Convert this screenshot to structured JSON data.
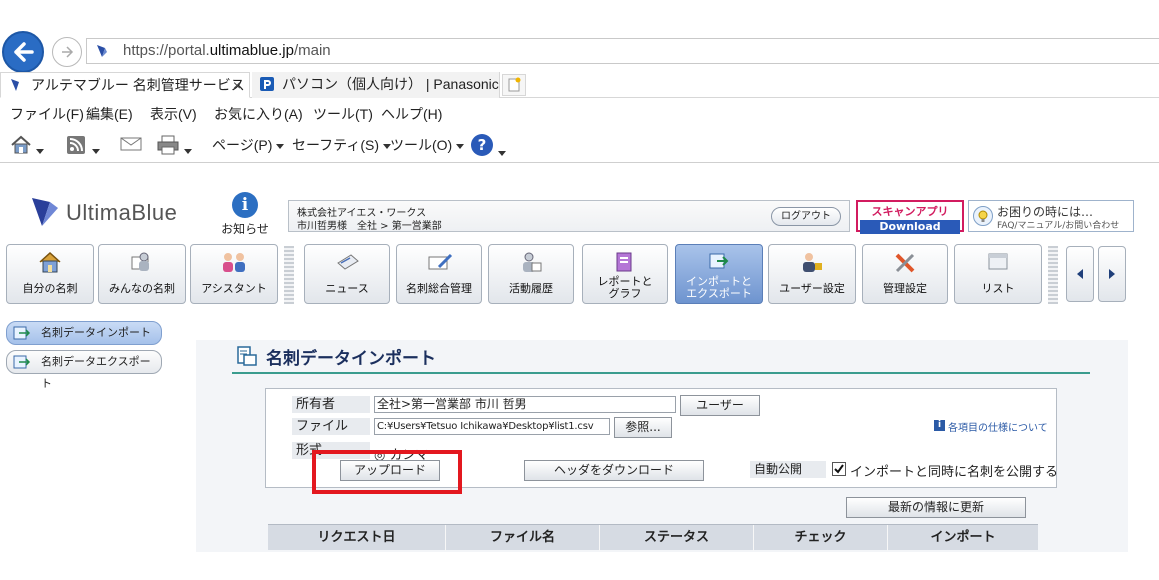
{
  "browser": {
    "url_prefix": "https://portal.",
    "url_domain": "ultimablue.jp",
    "url_path": "/main",
    "tabs": [
      {
        "label": "アルテマブルー 名刺管理サービス",
        "close": "×"
      },
      {
        "label": "パソコン（個人向け） | Panasonic"
      }
    ],
    "menu": [
      "ファイル(F)",
      "編集(E)",
      "表示(V)",
      "お気に入り(A)",
      "ツール(T)",
      "ヘルプ(H)"
    ],
    "command": {
      "page": "ページ(P)",
      "safety": "セーフティ(S)",
      "tools": "ツール(O)"
    }
  },
  "header": {
    "logo_text": "UltimaBlue",
    "info_glyph": "i",
    "info_label": "お知らせ",
    "company_name": "株式会社アイエス・ワークス",
    "user_line": "市川哲男様　全社 > 第一営業部",
    "logout": "ログアウト",
    "scan_title": "スキャンアプリ",
    "scan_download": "Download",
    "help_title": "お困りの時には…",
    "help_sub": "FAQ/マニュアル/お問い合わせ"
  },
  "nav": {
    "my_cards": "自分の名刺",
    "everyone_cards": "みんなの名刺",
    "assistant": "アシスタント",
    "news": "ニュース",
    "card_mgmt": "名刺総合管理",
    "activity": "活動履歴",
    "report_1": "レポートと",
    "report_2": "グラフ",
    "import_1": "インポートと",
    "import_2": "エクスポート",
    "user_settings": "ユーザー設定",
    "admin_settings": "管理設定",
    "list": "リスト"
  },
  "subnav": {
    "import": "名刺データインポート",
    "export": "名刺データエクスポート"
  },
  "page": {
    "title": "名刺データインポート",
    "owner_label": "所有者",
    "owner_value": "全社>第一営業部  市川 哲男",
    "user_button": "ユーザー",
    "file_label": "ファイル",
    "file_value": "C:¥Users¥Tetsuo Ichikawa¥Desktop¥list1.csv",
    "browse_button": "参照...",
    "spec_link": "各項目の仕様について",
    "format_label": "形式",
    "format_value": "◎ カンマ",
    "upload_button": "アップロード",
    "header_download": "ヘッダをダウンロード",
    "autopub_label": "自動公開",
    "autopub_text": "インポートと同時に名刺を公開する",
    "refresh_button": "最新の情報に更新",
    "columns": [
      "リクエスト日",
      "ファイル名",
      "ステータス",
      "チェック",
      "インポート"
    ]
  },
  "colors": {
    "accent": "#2a6cc4",
    "highlight": "#e3181f",
    "teal_line": "#3a9c8e"
  }
}
